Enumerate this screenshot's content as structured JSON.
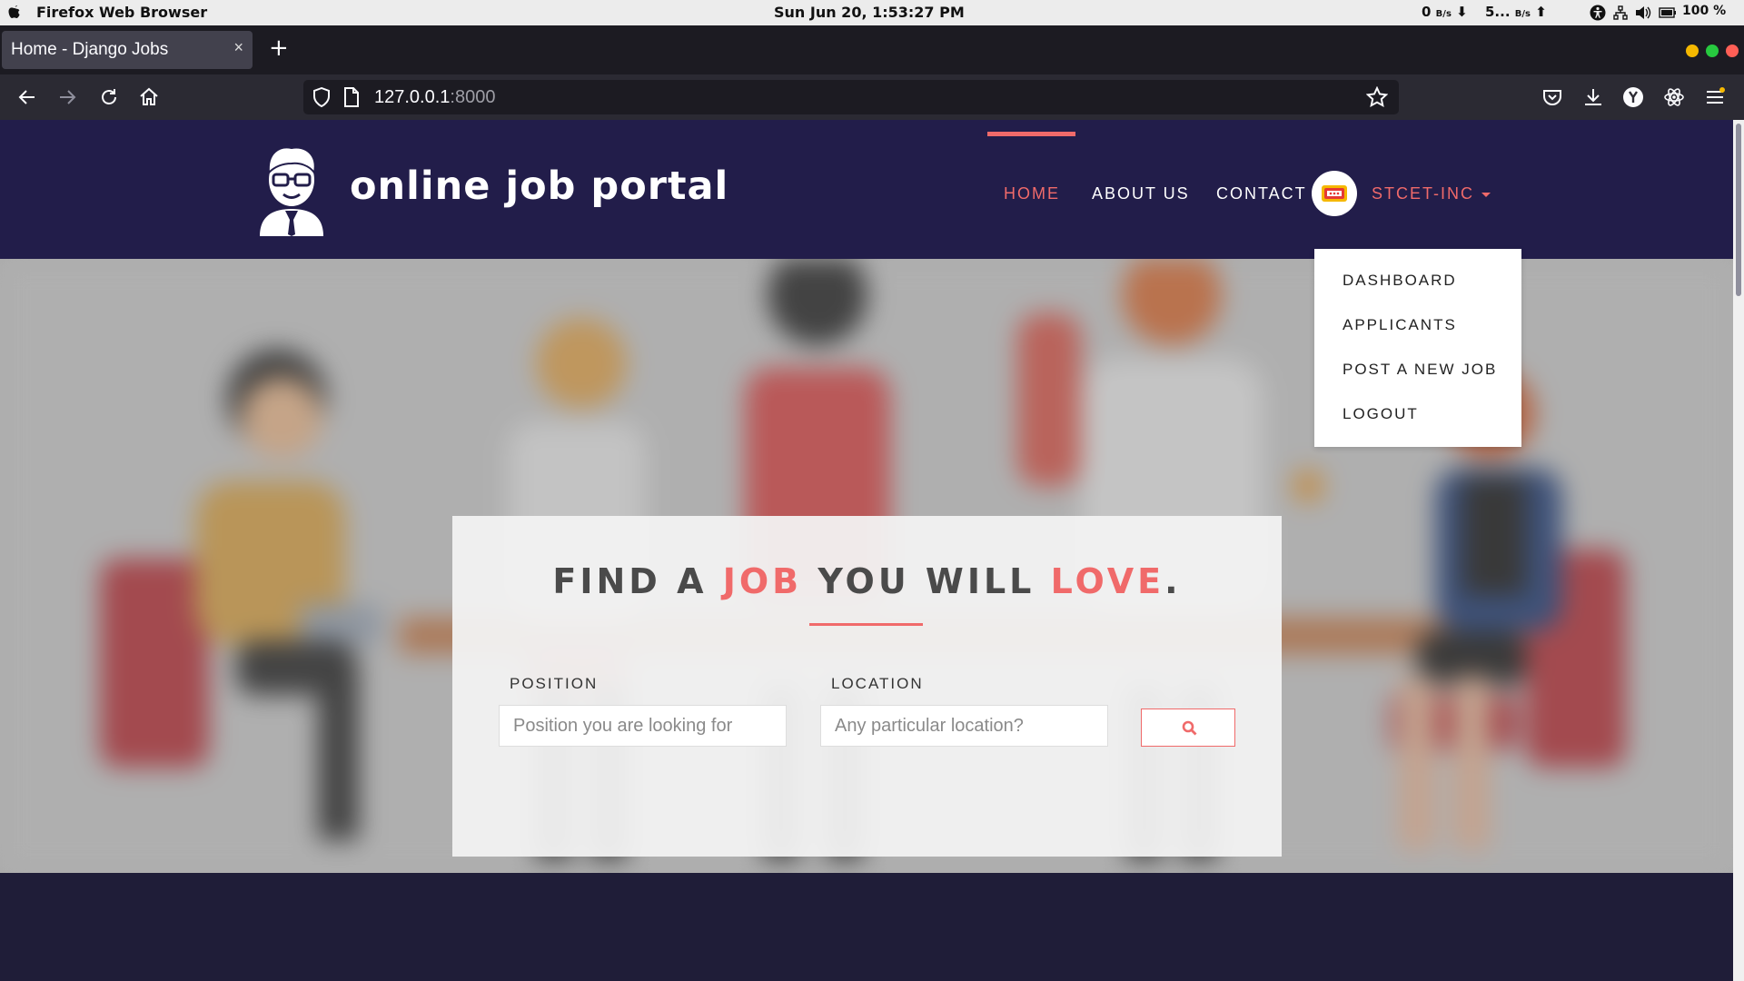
{
  "os": {
    "app_name": "Firefox Web Browser",
    "clock": "Sun Jun 20,  1:53:27 PM",
    "net_down_value": "0",
    "net_down_unit": "B/s",
    "net_up_value": "5...",
    "net_up_unit": "B/s",
    "battery_percent": "100 %"
  },
  "browser": {
    "tab_title": "Home - Django Jobs",
    "tab_close": "×",
    "new_tab": "+",
    "url_host": "127.0.0.1",
    "url_port": ":8000",
    "window_dots": [
      "#f5b800",
      "#27c93f",
      "#ff5f56"
    ]
  },
  "site": {
    "logo_text": "online job portal",
    "nav": {
      "home": "HOME",
      "about": "ABOUT US",
      "contact": "CONTACT",
      "user": "STCET-INC"
    },
    "dropdown": [
      "DASHBOARD",
      "APPLICANTS",
      "POST A NEW JOB",
      "LOGOUT"
    ],
    "hero": {
      "headline_part1": "FIND A ",
      "headline_highlight1": "JOB",
      "headline_part2": " YOU WILL ",
      "headline_highlight2": "LOVE",
      "headline_end": ".",
      "position_label": "POSITION",
      "position_placeholder": "Position you are looking for",
      "location_label": "LOCATION",
      "location_placeholder": "Any particular location?"
    },
    "colors": {
      "accent": "#f06a6a",
      "header_bg": "#221d4a",
      "footer_bg": "#1f1d38"
    }
  }
}
